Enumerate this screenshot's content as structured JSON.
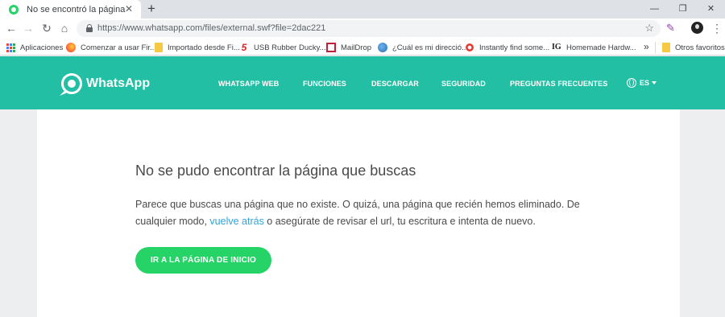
{
  "browser": {
    "tab": {
      "title": "No se encontró la página",
      "close": "✕"
    },
    "new_tab": "+",
    "window_controls": {
      "minimize": "—",
      "restore": "❐",
      "close": "✕"
    },
    "nav": {
      "back": "←",
      "forward": "→",
      "reload": "↻",
      "home": "⌂"
    },
    "url": "https://www.whatsapp.com/files/external.swf?file=2dac221",
    "star": "☆",
    "extension": "✎",
    "menu": "⋮",
    "bookmarks": [
      {
        "label": "Aplicaciones",
        "icon": "apps-icon"
      },
      {
        "label": "Comenzar a usar Fir...",
        "icon": "firefox-icon"
      },
      {
        "label": "Importado desde Fi...",
        "icon": "folder-icon"
      },
      {
        "label": "USB Rubber Ducky...",
        "icon": "hak5-icon"
      },
      {
        "label": "MailDrop",
        "icon": "maildrop-icon"
      },
      {
        "label": "¿Cuál es mi direcció...",
        "icon": "globe-icon"
      },
      {
        "label": "Instantly find some...",
        "icon": "red-dot-icon"
      },
      {
        "label": "Homemade Hardw...",
        "icon": "ig-icon"
      }
    ],
    "bookmarks_overflow": "»",
    "other_bookmarks": "Otros favoritos"
  },
  "site": {
    "brand": "WhatsApp",
    "nav": [
      "WHATSAPP WEB",
      "FUNCIONES",
      "DESCARGAR",
      "SEGURIDAD",
      "PREGUNTAS FRECUENTES"
    ],
    "language": "ES",
    "error": {
      "title": "No se pudo encontrar la página que buscas",
      "text_before": "Parece que buscas una página que no existe. O quizá, una página que recién hemos eliminado. De cualquier modo, ",
      "link": "vuelve atrás",
      "text_after": " o asegúrate de revisar el url, tu escritura e intenta de nuevo.",
      "button": "IR A LA PÁGINA DE INICIO"
    }
  },
  "colors": {
    "header": "#22bfa4",
    "button": "#25d366",
    "link": "#34a4d8"
  }
}
